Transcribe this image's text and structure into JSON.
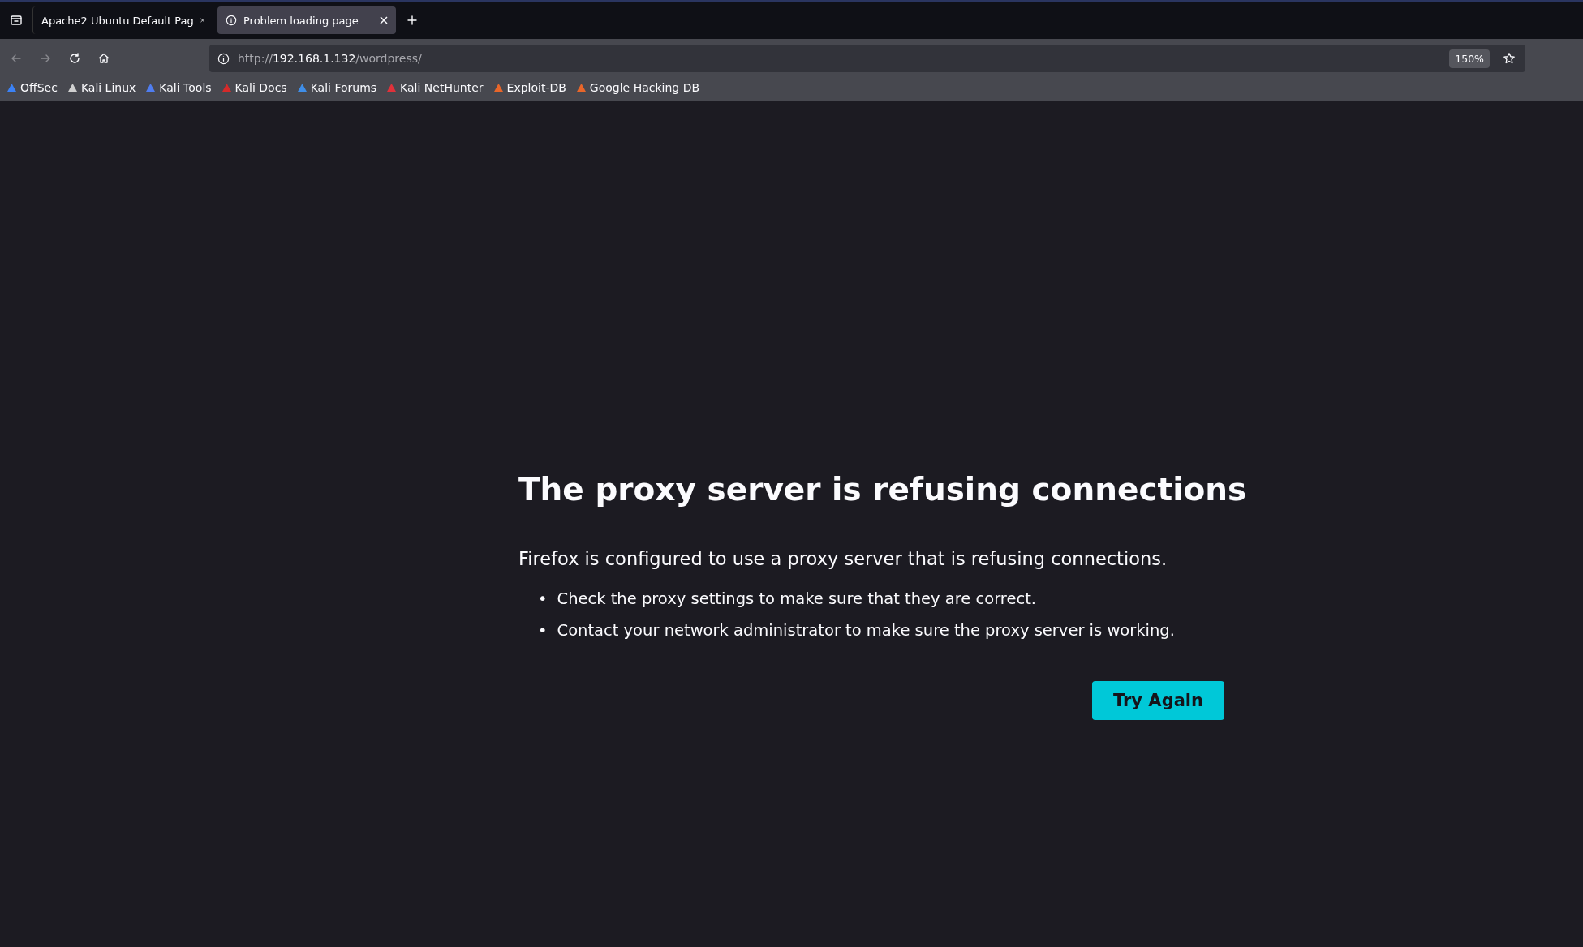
{
  "tabs": [
    {
      "title": "Apache2 Ubuntu Default Pag",
      "selected": false,
      "has_info_icon": false
    },
    {
      "title": "Problem loading page",
      "selected": true,
      "has_info_icon": true
    }
  ],
  "address_bar": {
    "scheme": "http://",
    "host": "192.168.1.132",
    "path": "/wordpress/",
    "zoom": "150%"
  },
  "bookmarks": [
    {
      "label": "OffSec",
      "color": "#3b82f6"
    },
    {
      "label": "Kali Linux",
      "color": "#d0d0d0"
    },
    {
      "label": "Kali Tools",
      "color": "#4f7df0"
    },
    {
      "label": "Kali Docs",
      "color": "#d42a2a"
    },
    {
      "label": "Kali Forums",
      "color": "#3f8ee8"
    },
    {
      "label": "Kali NetHunter",
      "color": "#e0313a"
    },
    {
      "label": "Exploit-DB",
      "color": "#e8662a"
    },
    {
      "label": "Google Hacking DB",
      "color": "#e8662a"
    }
  ],
  "error_page": {
    "title": "The proxy server is refusing connections",
    "description": "Firefox is configured to use a proxy server that is refusing connections.",
    "suggestions": [
      {
        "bullet": "•",
        "text": "Check the proxy settings to make sure that they are correct."
      },
      {
        "bullet": "•",
        "text": "Contact your network administrator to make sure the proxy server is working."
      }
    ],
    "button": "Try Again"
  }
}
